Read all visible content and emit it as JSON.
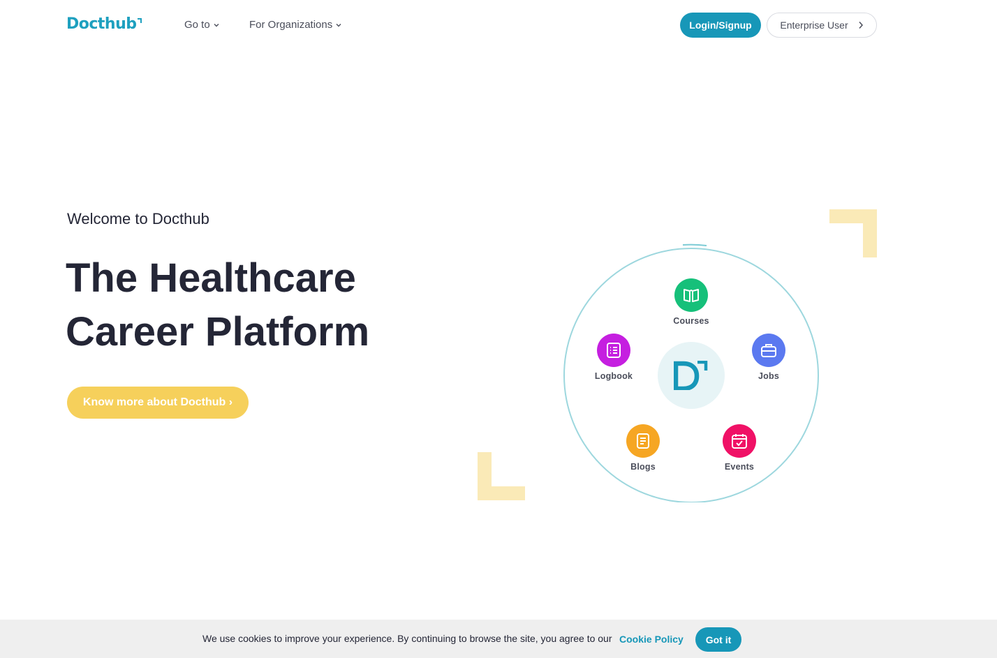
{
  "header": {
    "logo_text": "Docthub",
    "nav": [
      {
        "label": "Go to"
      },
      {
        "label": "For Organizations"
      }
    ],
    "login_label": "Login/Signup",
    "enterprise_label": "Enterprise User"
  },
  "hero": {
    "welcome": "Welcome to Docthub",
    "title_line1": "The Healthcare",
    "title_line2": "Career Platform",
    "cta_label": "Know more about Docthub ›"
  },
  "diagram": {
    "center_letter": "D",
    "nodes": [
      {
        "label": "Courses",
        "icon": "book-icon",
        "color": "#16c07a"
      },
      {
        "label": "Logbook",
        "icon": "list-icon",
        "color": "#c51fe0"
      },
      {
        "label": "Jobs",
        "icon": "briefcase-icon",
        "color": "#5b79f0"
      },
      {
        "label": "Blogs",
        "icon": "document-icon",
        "color": "#f6a623"
      },
      {
        "label": "Events",
        "icon": "calendar-icon",
        "color": "#f01166"
      }
    ]
  },
  "cookie": {
    "text": "We use cookies to improve your experience. By continuing to browse the site, you agree to our",
    "policy_label": "Cookie Policy",
    "accept_label": "Got it"
  },
  "colors": {
    "brand": "#1797b8",
    "accent_yellow": "#f6d05b",
    "decor_yellow": "#faeab7",
    "text_dark": "#242636"
  }
}
